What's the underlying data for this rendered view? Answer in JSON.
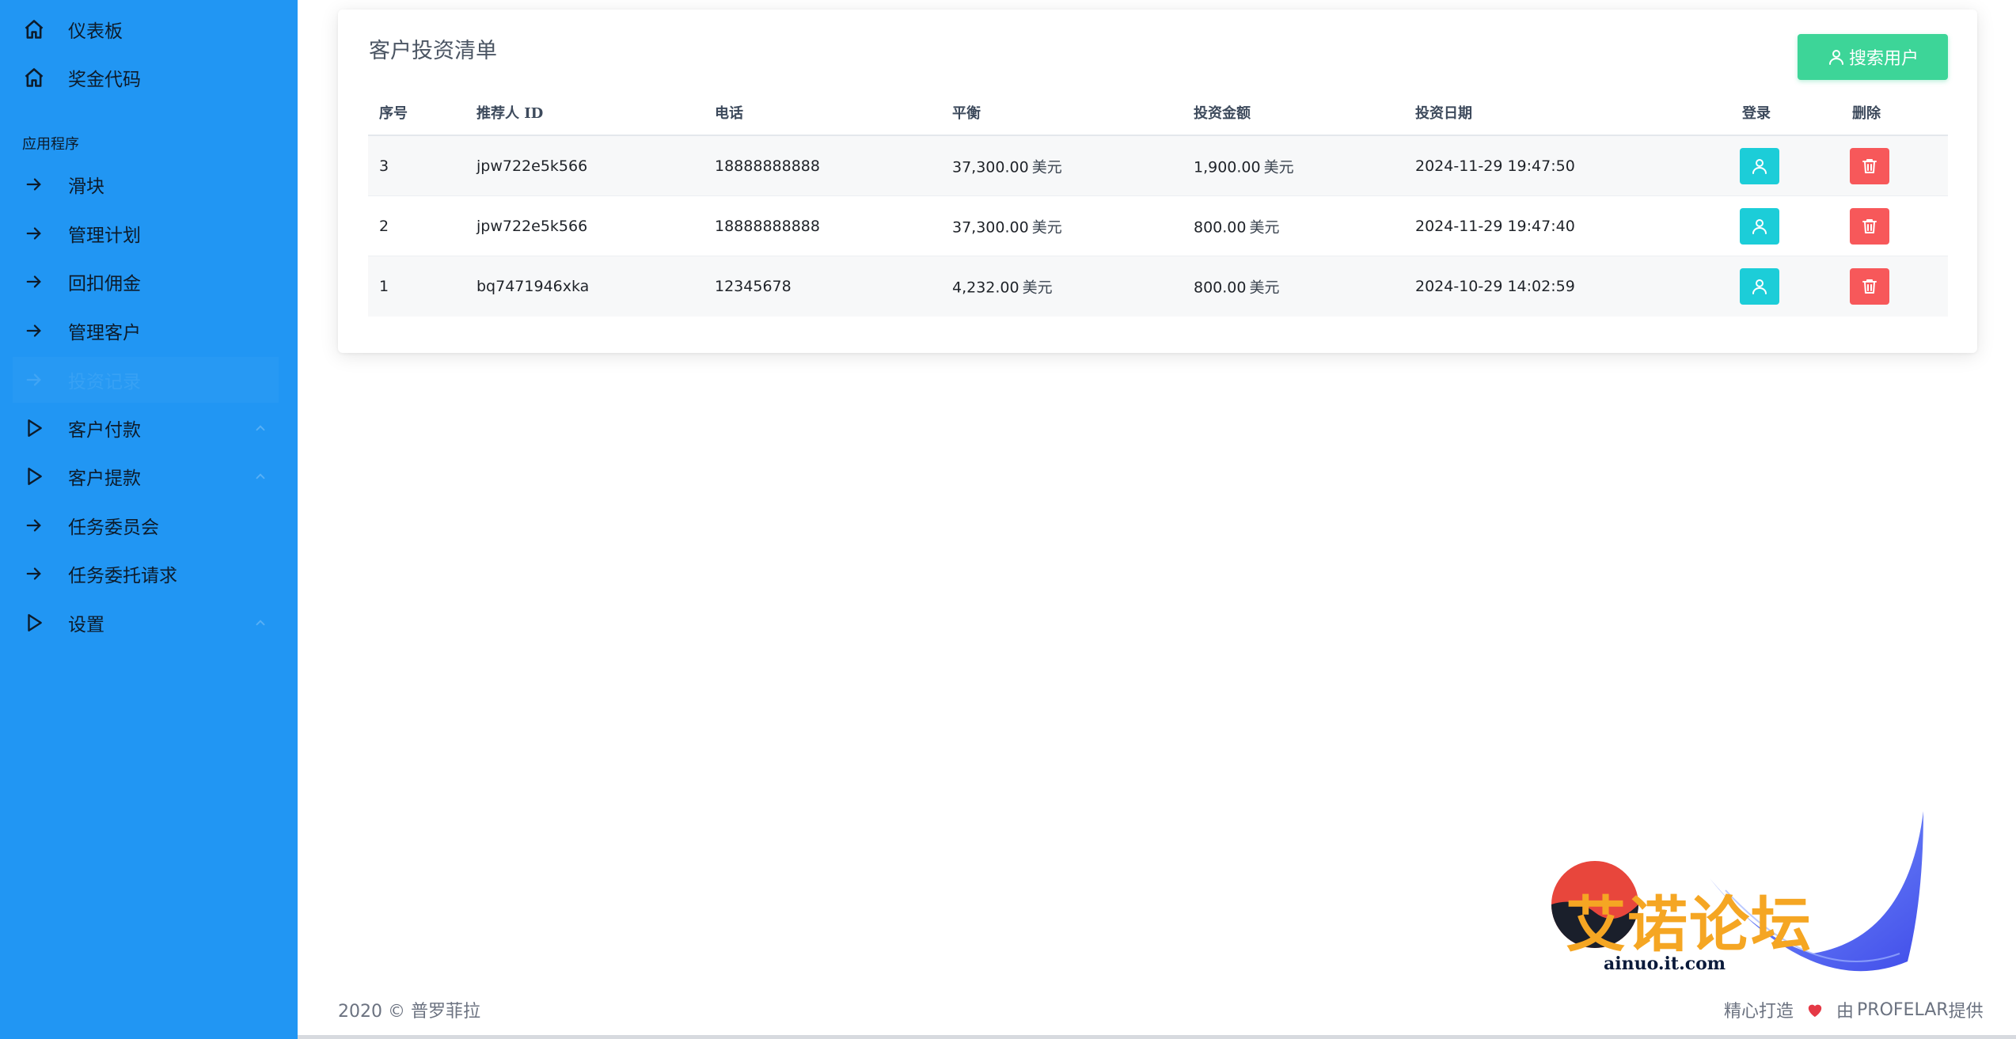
{
  "sidebar": {
    "top_items": [
      {
        "label": "仪表板",
        "icon": "home-icon"
      },
      {
        "label": "奖金代码",
        "icon": "home-icon"
      }
    ],
    "section_label": "应用程序",
    "items": [
      {
        "label": "滑块",
        "icon": "arrow-right-icon"
      },
      {
        "label": "管理计划",
        "icon": "arrow-right-icon"
      },
      {
        "label": "回扣佣金",
        "icon": "arrow-right-icon"
      },
      {
        "label": "管理客户",
        "icon": "arrow-right-icon"
      },
      {
        "label": "投资记录",
        "icon": "arrow-right-icon",
        "active": true
      },
      {
        "label": "客户付款",
        "icon": "play-icon",
        "expandable": true
      },
      {
        "label": "客户提款",
        "icon": "play-icon",
        "expandable": true
      },
      {
        "label": "任务委员会",
        "icon": "arrow-right-icon"
      },
      {
        "label": "任务委托请求",
        "icon": "arrow-right-icon"
      },
      {
        "label": "设置",
        "icon": "play-icon",
        "expandable": true
      }
    ]
  },
  "main": {
    "title": "客户投资清单",
    "search_button_label": "搜索用户",
    "table": {
      "headers": [
        "序号",
        "推荐人 ID",
        "电话",
        "平衡",
        "投资金额",
        "投资日期",
        "登录",
        "删除"
      ],
      "currency_unit": "美元",
      "rows": [
        {
          "index": "3",
          "referrer_id": "jpw722e5k566",
          "phone": "18888888888",
          "balance": "37,300.00",
          "amount": "1,900.00",
          "date": "2024-11-29 19:47:50"
        },
        {
          "index": "2",
          "referrer_id": "jpw722e5k566",
          "phone": "18888888888",
          "balance": "37,300.00",
          "amount": "800.00",
          "date": "2024-11-29 19:47:40"
        },
        {
          "index": "1",
          "referrer_id": "bq7471946xka",
          "phone": "12345678",
          "balance": "4,232.00",
          "amount": "800.00",
          "date": "2024-10-29 14:02:59"
        }
      ]
    }
  },
  "footer": {
    "left_year": "2020 ©",
    "left_name": "普罗菲拉",
    "right_prefix": "精心打造",
    "right_by": "由",
    "right_brand": "PROFELAR",
    "right_suffix": "提供"
  },
  "watermark": {
    "title": "艾诺论坛",
    "url": "ainuo.it.com"
  },
  "colors": {
    "sidebar": "#2196f3",
    "search_button": "#3dd598",
    "login_button": "#1ccdd8",
    "delete_button": "#f7585a",
    "heart": "#e53946"
  }
}
